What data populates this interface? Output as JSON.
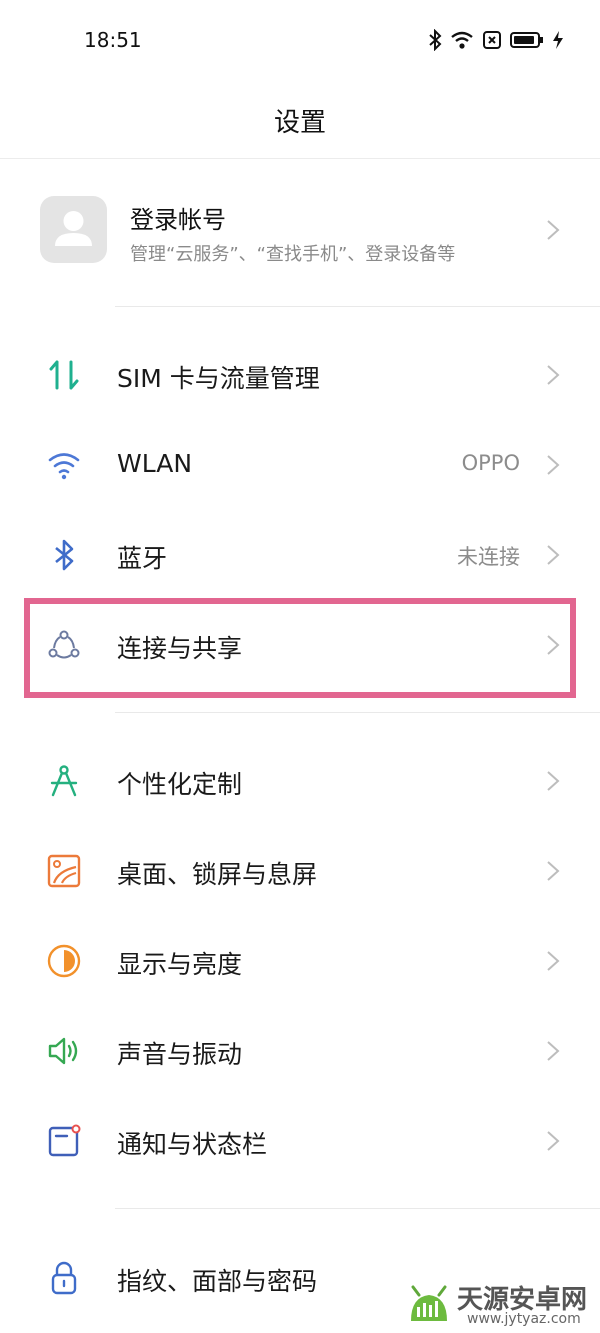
{
  "status": {
    "time": "18:51"
  },
  "header": {
    "title": "设置"
  },
  "account": {
    "name": "登录帐号",
    "description": "管理“云服务”、“查找手机”、登录设备等"
  },
  "items": [
    {
      "label": "SIM 卡与流量管理",
      "value": "",
      "icon": "sim-data-icon",
      "color": "#1fb08f"
    },
    {
      "label": "WLAN",
      "value": "OPPO",
      "icon": "wifi-icon",
      "color": "#4d78d6"
    },
    {
      "label": "蓝牙",
      "value": "未连接",
      "icon": "bluetooth-icon",
      "color": "#3f6cc9"
    },
    {
      "label": "连接与共享",
      "value": "",
      "icon": "connection-share-icon",
      "color": "#6c7aa0"
    },
    {
      "label": "个性化定制",
      "value": "",
      "icon": "compass-icon",
      "color": "#24b07f"
    },
    {
      "label": "桌面、锁屏与息屏",
      "value": "",
      "icon": "wallpaper-icon",
      "color": "#ec7a3a"
    },
    {
      "label": "显示与亮度",
      "value": "",
      "icon": "brightness-icon",
      "color": "#f2912b"
    },
    {
      "label": "声音与振动",
      "value": "",
      "icon": "speaker-icon",
      "color": "#35a852"
    },
    {
      "label": "通知与状态栏",
      "value": "",
      "icon": "notification-icon",
      "color": "#3f5fb8"
    },
    {
      "label": "指纹、面部与密码",
      "value": "",
      "icon": "lock-icon",
      "color": "#3f6cc9"
    }
  ],
  "highlight_color": "#e26690",
  "watermark": {
    "title": "天源安卓网",
    "url": "www.jytyaz.com"
  }
}
